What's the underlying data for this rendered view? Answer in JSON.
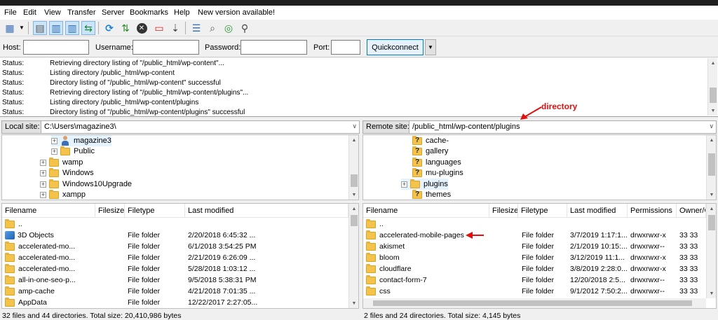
{
  "menu": [
    "File",
    "Edit",
    "View",
    "Transfer",
    "Server",
    "Bookmarks",
    "Help",
    "New version available!"
  ],
  "toolbar_icons": [
    "site-manager-icon",
    "site-manager-dropdown-icon",
    "toggle-message-log-icon",
    "toggle-local-tree-icon",
    "toggle-remote-tree-icon",
    "toggle-transfer-queue-icon",
    "refresh-icon",
    "process-queue-icon",
    "cancel-icon",
    "disconnect-icon",
    "reconnect-icon",
    "directory-listing-filters-icon",
    "toggle-directory-comparison-icon",
    "synchronized-browsing-icon",
    "search-remote-files-icon"
  ],
  "quickconnect": {
    "host_label": "Host:",
    "host_value": "",
    "username_label": "Username:",
    "username_value": "",
    "password_label": "Password:",
    "password_value": "",
    "port_label": "Port:",
    "port_value": "",
    "button": "Quickconnect"
  },
  "log": [
    {
      "label": "Status:",
      "message": "Retrieving directory listing of \"/public_html/wp-content\"..."
    },
    {
      "label": "Status:",
      "message": "Listing directory /public_html/wp-content"
    },
    {
      "label": "Status:",
      "message": "Directory listing of \"/public_html/wp-content\" successful"
    },
    {
      "label": "Status:",
      "message": "Retrieving directory listing of \"/public_html/wp-content/plugins\"..."
    },
    {
      "label": "Status:",
      "message": "Listing directory /public_html/wp-content/plugins"
    },
    {
      "label": "Status:",
      "message": "Directory listing of \"/public_html/wp-content/plugins\" successful"
    }
  ],
  "annotations": {
    "directory": "directory"
  },
  "local": {
    "site_label": "Local site:",
    "path": "C:\\Users\\magazine3\\",
    "tree": [
      {
        "name": "magazine3",
        "icon": "user-icon",
        "expander": "+"
      },
      {
        "name": "Public",
        "icon": "folder-icon",
        "expander": "+"
      },
      {
        "name": "wamp",
        "icon": "folder-icon",
        "expander": "+"
      },
      {
        "name": "Windows",
        "icon": "folder-icon",
        "expander": "+"
      },
      {
        "name": "Windows10Upgrade",
        "icon": "folder-icon",
        "expander": "+"
      },
      {
        "name": "xampp",
        "icon": "folder-icon",
        "expander": "+"
      }
    ],
    "columns": [
      "Filename",
      "Filesize",
      "Filetype",
      "Last modified"
    ],
    "rows": [
      {
        "name": "..",
        "size": "",
        "type": "",
        "modified": ""
      },
      {
        "name": "3D Objects",
        "size": "",
        "type": "File folder",
        "modified": "2/20/2018 6:45:32 ..."
      },
      {
        "name": "accelerated-mo...",
        "size": "",
        "type": "File folder",
        "modified": "6/1/2018 3:54:25 PM"
      },
      {
        "name": "accelerated-mo...",
        "size": "",
        "type": "File folder",
        "modified": "2/21/2019 6:26:09 ..."
      },
      {
        "name": "accelerated-mo...",
        "size": "",
        "type": "File folder",
        "modified": "5/28/2018 1:03:12 ..."
      },
      {
        "name": "all-in-one-seo-p...",
        "size": "",
        "type": "File folder",
        "modified": "9/5/2018 5:38:31 PM"
      },
      {
        "name": "amp-cache",
        "size": "",
        "type": "File folder",
        "modified": "4/21/2018 7:01:35 ..."
      },
      {
        "name": "AppData",
        "size": "",
        "type": "File folder",
        "modified": "12/22/2017 2:27:05..."
      }
    ],
    "status": "32 files and 44 directories. Total size: 20,410,986 bytes"
  },
  "remote": {
    "site_label": "Remote site:",
    "path": "/public_html/wp-content/plugins",
    "tree": [
      {
        "name": "cache-",
        "expander": ""
      },
      {
        "name": "gallery",
        "expander": ""
      },
      {
        "name": "languages",
        "expander": ""
      },
      {
        "name": "mu-plugins",
        "expander": ""
      },
      {
        "name": "plugins",
        "expander": "+"
      },
      {
        "name": "themes",
        "expander": ""
      }
    ],
    "columns": [
      "Filename",
      "Filesize",
      "Filetype",
      "Last modified",
      "Permissions",
      "Owner/G"
    ],
    "rows": [
      {
        "name": "..",
        "size": "",
        "type": "",
        "modified": "",
        "perms": "",
        "owner": ""
      },
      {
        "name": "accelerated-mobile-pages",
        "size": "",
        "type": "File folder",
        "modified": "3/7/2019 1:17:1...",
        "perms": "drwxrwxr-x",
        "owner": "33 33"
      },
      {
        "name": "akismet",
        "size": "",
        "type": "File folder",
        "modified": "2/1/2019 10:15:...",
        "perms": "drwxrwxr--",
        "owner": "33 33"
      },
      {
        "name": "bloom",
        "size": "",
        "type": "File folder",
        "modified": "3/12/2019 11:1...",
        "perms": "drwxrwxr-x",
        "owner": "33 33"
      },
      {
        "name": "cloudflare",
        "size": "",
        "type": "File folder",
        "modified": "3/8/2019 2:28:0...",
        "perms": "drwxrwxr-x",
        "owner": "33 33"
      },
      {
        "name": "contact-form-7",
        "size": "",
        "type": "File folder",
        "modified": "12/20/2018 2:5...",
        "perms": "drwxrwxr--",
        "owner": "33 33"
      },
      {
        "name": "css",
        "size": "",
        "type": "File folder",
        "modified": "9/1/2012 7:50:2...",
        "perms": "drwxrwxr--",
        "owner": "33 33"
      }
    ],
    "status": "2 files and 24 directories. Total size: 4,145 bytes"
  },
  "colors": {
    "accent_red": "#e01010",
    "selection": "#e5f3ff",
    "folder": "#f3c34b"
  }
}
